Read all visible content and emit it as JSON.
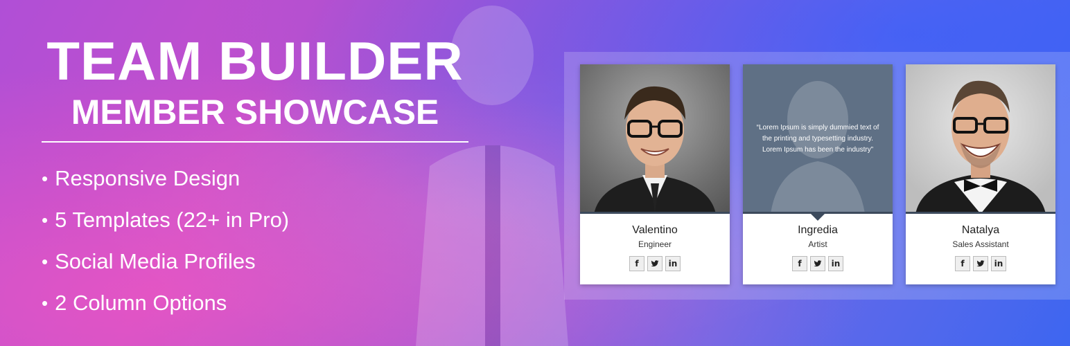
{
  "hero": {
    "title": "TEAM BUILDER",
    "subtitle": "MEMBER SHOWCASE",
    "features": [
      "Responsive Design",
      "5 Templates (22+ in Pro)",
      "Social Media Profiles",
      "2 Column Options"
    ]
  },
  "members": [
    {
      "name": "Valentino",
      "role": "Engineer"
    },
    {
      "name": "Ingredia",
      "role": "Artist",
      "quote": "“Lorem Ipsum is simply dummied text of the printing and typesetting industry. Lorem Ipsum has been the industry”"
    },
    {
      "name": "Natalya",
      "role": "Sales Assistant"
    }
  ],
  "social_icons": [
    "facebook-icon",
    "twitter-icon",
    "linkedin-icon"
  ],
  "social_glyphs": {
    "facebook": "f",
    "twitter": "🐦",
    "linkedin": "in"
  },
  "colors": {
    "gradient_start": "#b04fd6",
    "gradient_end": "#3d66f0",
    "card_accent": "#3c4a5c",
    "quote_bg": "#5f7085"
  }
}
